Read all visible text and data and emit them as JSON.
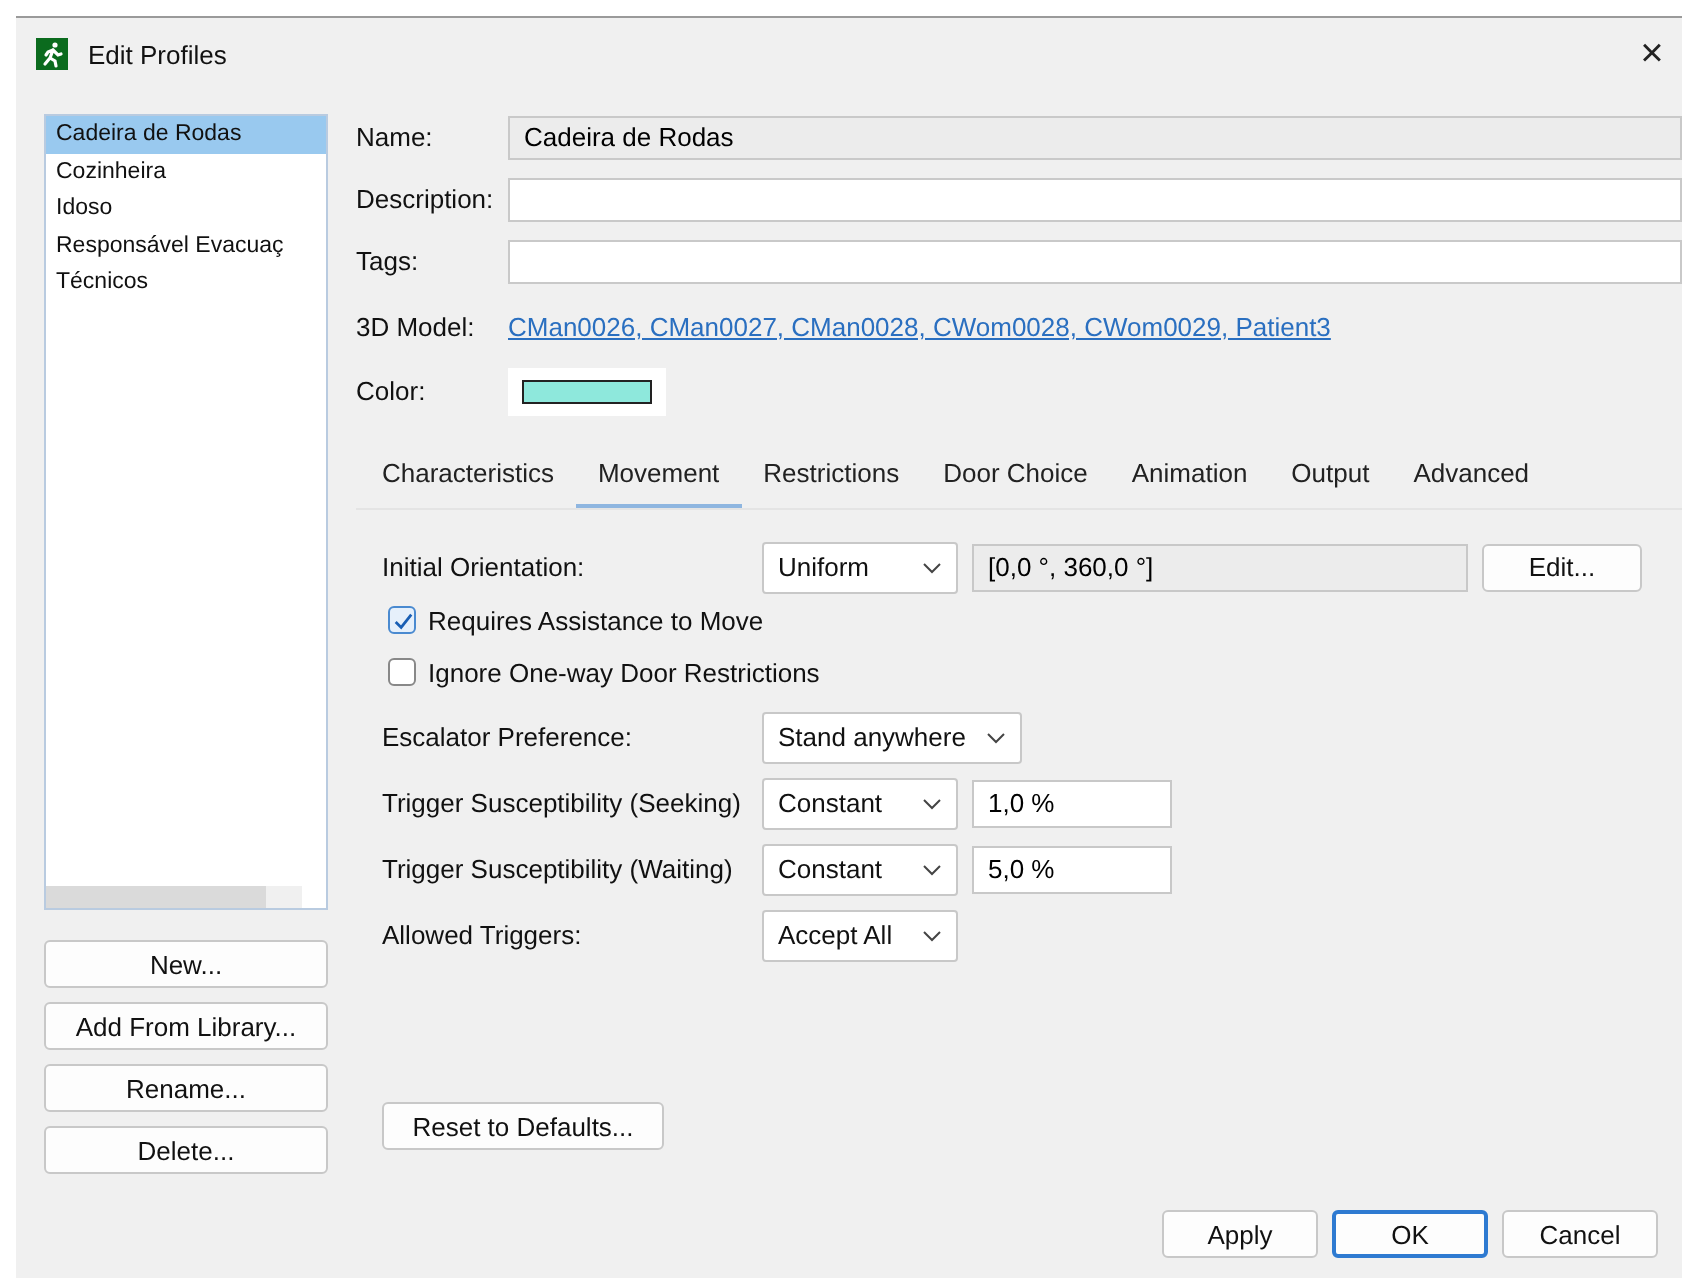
{
  "window": {
    "title": "Edit Profiles",
    "close": "×"
  },
  "profiles": [
    {
      "label": "Cadeira de Rodas",
      "selected": true
    },
    {
      "label": "Cozinheira",
      "selected": false
    },
    {
      "label": "Idoso",
      "selected": false
    },
    {
      "label": "Responsável Evacuaç",
      "selected": false
    },
    {
      "label": "Técnicos",
      "selected": false
    }
  ],
  "profile_buttons": [
    "New...",
    "Add From Library...",
    "Rename...",
    "Delete..."
  ],
  "form": {
    "name_label": "Name:",
    "name": "Cadeira de Rodas",
    "description_label": "Description:",
    "tags_label": "Tags:",
    "model_label": "3D Model:",
    "model_link": "CMan0026, CMan0027, CMan0028, CWom0028, CWom0029, Patient3",
    "color_label": "Color:",
    "color": "#8ee8dc"
  },
  "tabs": [
    {
      "label": "Characteristics",
      "selected": false
    },
    {
      "label": "Movement",
      "selected": true
    },
    {
      "label": "Restrictions",
      "selected": false
    },
    {
      "label": "Door Choice",
      "selected": false
    },
    {
      "label": "Animation",
      "selected": false
    },
    {
      "label": "Output",
      "selected": false
    },
    {
      "label": "Advanced",
      "selected": false
    }
  ],
  "settings": [
    {
      "kind": "field",
      "label": "Initial Orientation:",
      "select": "Uniform",
      "value": "[0,0 °, 360,0 °]",
      "value_readonly": true,
      "button": "Edit..."
    },
    {
      "kind": "checkbox",
      "label": "Requires Assistance to Move",
      "checked": true
    },
    {
      "kind": "checkbox",
      "label": "Ignore One-way Door Restrictions",
      "checked": false
    },
    {
      "kind": "field",
      "label": "Escalator Preference:",
      "select": "Stand anywhere"
    },
    {
      "kind": "field",
      "label": "Trigger Susceptibility (Seeking)",
      "select": "Constant",
      "value": "1,0 %",
      "value_readonly": false
    },
    {
      "kind": "field",
      "label": "Trigger Susceptibility (Waiting)",
      "select": "Constant",
      "value": "5,0 %",
      "value_readonly": false
    },
    {
      "kind": "field",
      "label": "Allowed Triggers:",
      "select": "Accept All"
    }
  ],
  "reset_button": "Reset to Defaults...",
  "dialog_buttons": [
    {
      "label": "Apply",
      "default": false
    },
    {
      "label": "OK",
      "default": true
    },
    {
      "label": "Cancel",
      "default": false
    }
  ]
}
